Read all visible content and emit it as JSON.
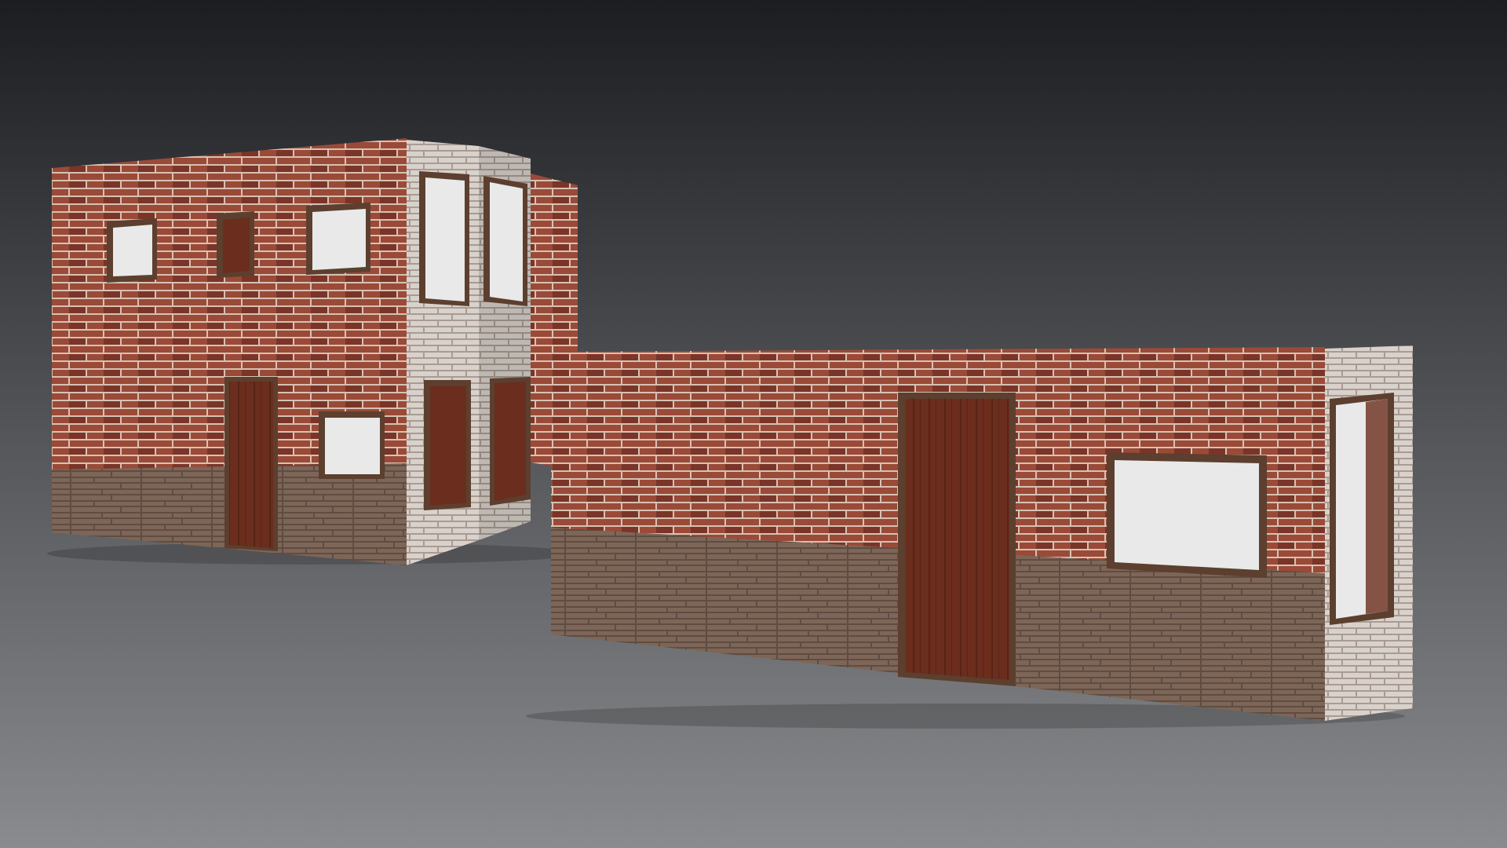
{
  "scene": {
    "background_top": "#1b1d21",
    "background_bottom": "#8a8b8e",
    "colors": {
      "red_brick": "#9b4a38",
      "red_brick_dark": "#7a3528",
      "brick_mortar": "#d6c2b4",
      "white_brick": "#d9d2cc",
      "white_brick_dark": "#a99b92",
      "stone_base": "#7d6657",
      "stone_base_dark": "#5f4c42",
      "wood_door": "#6b2d1d",
      "wood_door_dark": "#4a1e12",
      "window_frame": "#5c3f2e",
      "window_glass": "#e9e9ea"
    },
    "objects": [
      {
        "name": "two-storey-brick-building",
        "doors": 1,
        "windows": 8
      },
      {
        "name": "long-brick-wall-building",
        "doors": 1,
        "windows": 2
      }
    ]
  }
}
